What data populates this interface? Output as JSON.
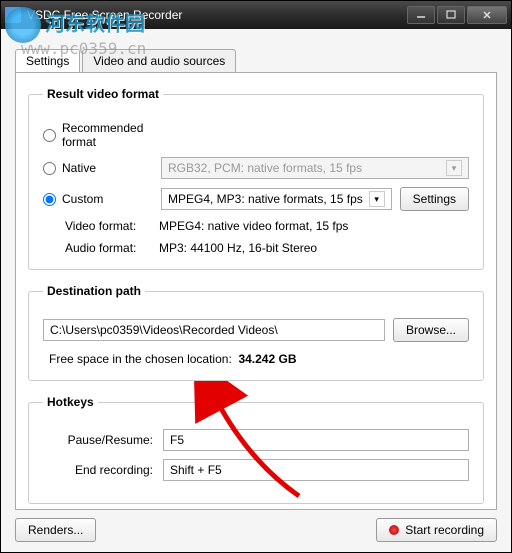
{
  "window": {
    "title": "VSDC Free Screen Recorder"
  },
  "watermark": {
    "text": "河东软件园",
    "url": "www.pc0359.cn"
  },
  "tabs": {
    "settings": "Settings",
    "sources": "Video and audio sources"
  },
  "result": {
    "legend": "Result video format",
    "recommended_label": "Recommended format",
    "native_label": "Native",
    "native_combo": "RGB32, PCM: native formats, 15 fps",
    "custom_label": "Custom",
    "custom_combo": "MPEG4, MP3: native formats, 15 fps",
    "settings_btn": "Settings",
    "video_format_label": "Video format:",
    "video_format_value": "MPEG4: native video format, 15 fps",
    "audio_format_label": "Audio format:",
    "audio_format_value": "MP3: 44100 Hz, 16-bit Stereo"
  },
  "destination": {
    "legend": "Destination path",
    "path": "C:\\Users\\pc0359\\Videos\\Recorded Videos\\",
    "browse": "Browse...",
    "free_space_label": "Free space in the chosen location:",
    "free_space_value": "34.242 GB"
  },
  "hotkeys": {
    "legend": "Hotkeys",
    "pause_label": "Pause/Resume:",
    "pause_value": "F5",
    "end_label": "End recording:",
    "end_value": "Shift + F5"
  },
  "bottom": {
    "renders": "Renders...",
    "start": "Start recording"
  }
}
